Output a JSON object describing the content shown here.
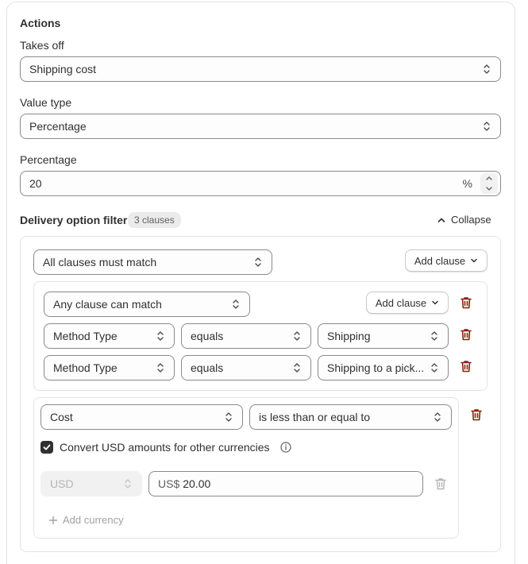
{
  "actions": {
    "heading": "Actions",
    "takes_off": {
      "label": "Takes off",
      "value": "Shipping cost"
    },
    "value_type": {
      "label": "Value type",
      "value": "Percentage"
    },
    "percentage": {
      "label": "Percentage",
      "value": "20",
      "suffix": "%"
    }
  },
  "delivery_filter": {
    "title": "Delivery option filter",
    "badge": "3 clauses",
    "collapse_label": "Collapse",
    "match_mode": "All clauses must match",
    "add_clause_label": "Add clause",
    "group": {
      "match_mode": "Any clause can match",
      "add_clause_label": "Add clause",
      "clauses": [
        {
          "field": "Method Type",
          "operator": "equals",
          "value": "Shipping"
        },
        {
          "field": "Method Type",
          "operator": "equals",
          "value": "Shipping to a pick..."
        }
      ]
    },
    "cost_clause": {
      "field": "Cost",
      "operator": "is less than or equal to",
      "convert_label": "Convert USD amounts for other currencies",
      "convert_checked": true,
      "currency": "USD",
      "amount_prefix": "US$",
      "amount": "20.00",
      "add_currency_label": "Add currency"
    }
  },
  "colors": {
    "danger": "#8e1f0b",
    "text": "#303030",
    "border": "#8a8a8a"
  }
}
